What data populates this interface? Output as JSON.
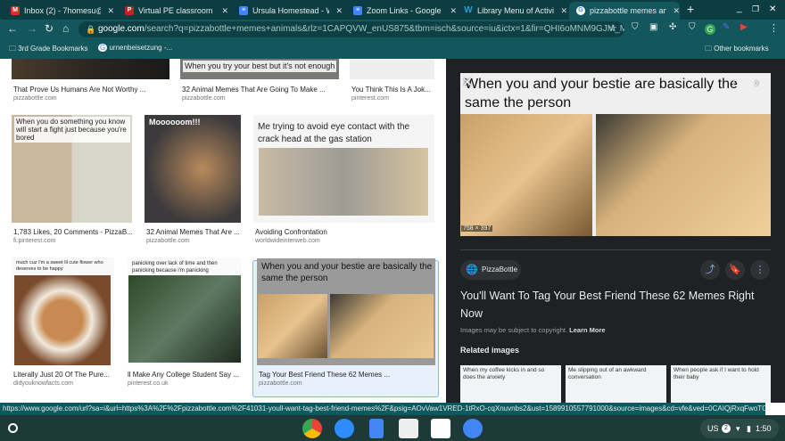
{
  "browser": {
    "tabs": [
      {
        "label": "Inbox (2) - 7homesu@w",
        "icon": "gmail-icon",
        "color": "#d93025"
      },
      {
        "label": "Virtual PE classroom (3",
        "icon": "pdf-icon",
        "color": "#c5221f"
      },
      {
        "label": "Ursula Homestead - Wo",
        "icon": "docs-icon",
        "color": "#4285f4"
      },
      {
        "label": "Zoom Links - Google Do",
        "icon": "docs-icon",
        "color": "#4285f4"
      },
      {
        "label": "Library Menu of Activitie",
        "icon": "weebly-icon",
        "color": "#2d9cdb"
      },
      {
        "label": "pizzabottle memes anim",
        "icon": "google-icon",
        "color": "#ffffff",
        "active": true
      }
    ],
    "url_host": "google.com",
    "url_path": "/search?q=pizzabottle+memes+animals&rlz=1CAPQVW_enUS875&tbm=isch&source=iu&ictx=1&fir=QHI6oMNM9GJM_M%253...",
    "bookmarks": [
      "3rd Grade Bookmarks",
      "urnenbeisetzung -..."
    ],
    "other_bookmarks": "Other bookmarks",
    "status_url": "https://www.google.com/url?sa=i&url=https%3A%2F%2Fpizzabottle.com%2F41031-youll-want-tag-best-friend-memes%2F&psig=AOvVaw1VRED-1tRxO-cqXnuvnbs2&ust=1589910557791000&source=images&cd=vfe&ved=0CAIQjRxqFwoTCIDt2c..."
  },
  "results": [
    {
      "title": "That Prove Us Humans Are Not Worthy ...",
      "site": "pizzabottle.com",
      "caption": ""
    },
    {
      "title": "32 Animal Memes That Are Going To Make ...",
      "site": "pizzabottle.com",
      "caption": "When you try your best but it's not enough"
    },
    {
      "title": "You Think This Is A Jok...",
      "site": "pinterest.com",
      "caption": ""
    },
    {
      "title": "1,783 Likes, 20 Comments - PizzaB...",
      "site": "fi.pinterest.com",
      "caption": "When you do something you know will start a fight just because you're bored"
    },
    {
      "title": "32 Animal Memes That Are ...",
      "site": "pizzabottle.com",
      "caption": "Moooooom!!!"
    },
    {
      "title": "Avoiding Confrontation",
      "site": "worldwideinterweb.com",
      "caption": "Me trying to avoid eye contact with the crack head at the gas station"
    },
    {
      "title": "Literally Just 20 Of The Pure...",
      "site": "didyouknowfacts.com",
      "caption": "much cuz I'm a sweet lil cute flower who deserves to be happy"
    },
    {
      "title": "ll Make Any College Student Say ...",
      "site": "pinterest.co.uk",
      "caption": "panicking over lack of time and then panicking because i'm panicking"
    },
    {
      "title": "Tag Your Best Friend These 62 Memes ...",
      "site": "pizzabottle.com",
      "caption": "When you and your bestie are basically the same the person",
      "selected": true
    }
  ],
  "preview": {
    "caption": "When you and your bestie are basically the same the person",
    "dimensions": "758 × 397",
    "source": "PizzaBottle",
    "title": "You'll Want To Tag Your Best Friend These 62 Memes Right Now",
    "copyright": "Images may be subject to copyright.",
    "learn_more": "Learn More",
    "related_heading": "Related images",
    "related": [
      "When my coffee kicks in and so does the anxiety",
      "Me slipping out of an awkward conversation",
      "When people ask if I want to hold their baby"
    ]
  },
  "shelf": {
    "locale": "US",
    "notifications": "2",
    "time": "1:50"
  }
}
